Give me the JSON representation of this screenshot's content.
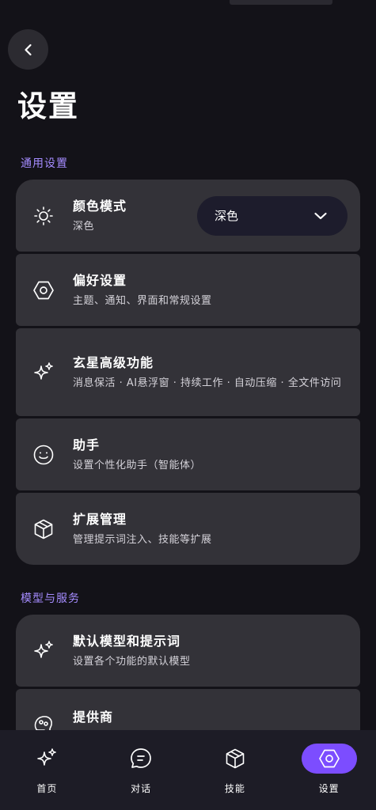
{
  "page": {
    "title": "设置"
  },
  "sections": [
    {
      "title": "通用设置"
    },
    {
      "title": "模型与服务"
    }
  ],
  "general": {
    "color_mode": {
      "title": "颜色模式",
      "subtitle": "深色",
      "select_value": "深色",
      "icon": "sun-icon"
    },
    "preferences": {
      "title": "偏好设置",
      "subtitle": "主题、通知、界面和常规设置",
      "icon": "hexagon-icon"
    },
    "advanced": {
      "title": "玄星高级功能",
      "subtitle": "消息保活 · AI悬浮窗 · 持续工作 · 自动压缩 · 全文件访问",
      "icon": "sparkle-icon"
    },
    "assistant": {
      "title": "助手",
      "subtitle": "设置个性化助手（智能体）",
      "icon": "smiley-icon"
    },
    "extensions": {
      "title": "扩展管理",
      "subtitle": "管理提示词注入、技能等扩展",
      "icon": "package-icon"
    }
  },
  "models": {
    "default_model": {
      "title": "默认模型和提示词",
      "subtitle": "设置各个功能的默认模型",
      "icon": "sparkle-icon"
    },
    "providers": {
      "title": "提供商",
      "icon": "brain-icon"
    }
  },
  "nav": {
    "items": [
      {
        "label": "首页",
        "icon": "sparkle-icon"
      },
      {
        "label": "对话",
        "icon": "chat-icon"
      },
      {
        "label": "技能",
        "icon": "package-icon"
      },
      {
        "label": "设置",
        "icon": "hexagon-icon",
        "active": true
      }
    ]
  },
  "colors": {
    "accent": "#7c4dff",
    "section_title": "#a58cff",
    "card": "#333238",
    "background": "#131218"
  }
}
